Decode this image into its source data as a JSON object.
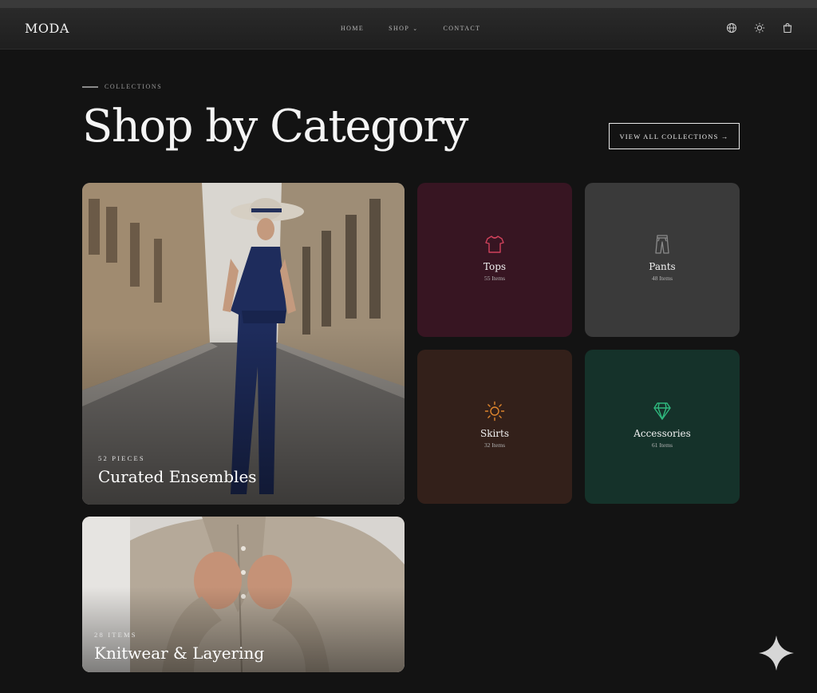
{
  "header": {
    "logo": "MODA",
    "nav": [
      {
        "label": "HOME"
      },
      {
        "label": "SHOP"
      },
      {
        "label": "CONTACT"
      }
    ],
    "icons": [
      "globe-icon",
      "sun-icon",
      "shopping-bag-icon"
    ]
  },
  "hero": {
    "eyebrow": "COLLECTIONS",
    "title": "Shop by Category",
    "cta": "VIEW ALL COLLECTIONS →"
  },
  "featured": [
    {
      "count": "52 PIECES",
      "title": "Curated Ensembles"
    },
    {
      "count": "28 ITEMS",
      "title": "Knitwear & Layering"
    }
  ],
  "categories": [
    {
      "label": "Tops",
      "count": "55 Items",
      "icon": "shirt-icon",
      "color": "#371522",
      "accent": "#d1425c"
    },
    {
      "label": "Pants",
      "count": "48 Items",
      "icon": "pants-icon",
      "color": "#3a3a3a",
      "accent": "#8a8a8a"
    },
    {
      "label": "Skirts",
      "count": "32 Items",
      "icon": "sun-icon",
      "color": "#33201a",
      "accent": "#e0862d"
    },
    {
      "label": "Accessories",
      "count": "61 Items",
      "icon": "diamond-icon",
      "color": "#15322a",
      "accent": "#2fb87e"
    }
  ]
}
